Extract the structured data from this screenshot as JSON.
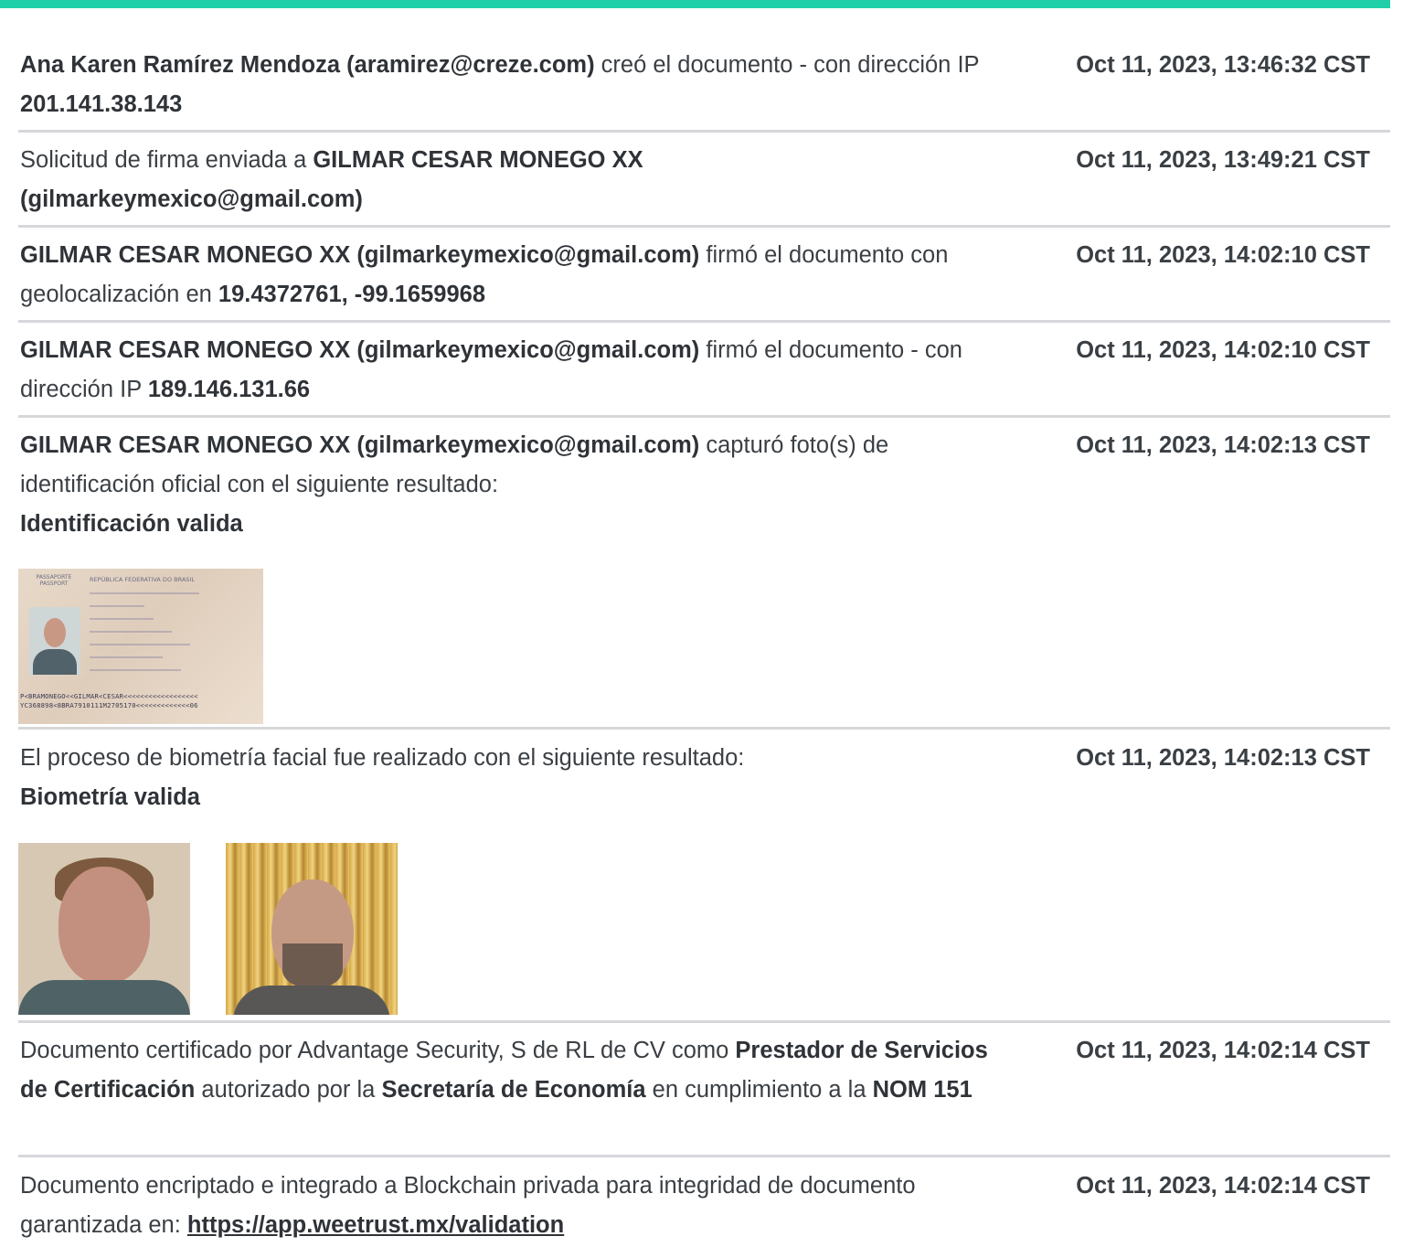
{
  "colors": {
    "accent_bar": "#21cfa8",
    "divider": "#d5d7da"
  },
  "events": [
    {
      "actor": "Ana Karen Ramírez Mendoza (aramirez@creze.com)",
      "action": " creó el documento - con dirección IP ",
      "ip": "201.141.38.143",
      "timestamp": "Oct 11, 2023, 13:46:32 CST"
    },
    {
      "prefix": "Solicitud de firma enviada a ",
      "actor": "GILMAR CESAR MONEGO XX (gilmarkeymexico@gmail.com)",
      "timestamp": "Oct 11, 2023, 13:49:21 CST"
    },
    {
      "actor": "GILMAR CESAR MONEGO XX (gilmarkeymexico@gmail.com)",
      "action": " firmó el documento con geolocalización en ",
      "geo": "19.4372761, -99.1659968",
      "timestamp": "Oct 11, 2023, 14:02:10 CST"
    },
    {
      "actor": "GILMAR CESAR MONEGO XX (gilmarkeymexico@gmail.com)",
      "action": " firmó el documento - con dirección IP ",
      "ip": "189.146.131.66",
      "timestamp": "Oct 11, 2023, 14:02:10 CST"
    },
    {
      "actor": "GILMAR CESAR MONEGO XX (gilmarkeymexico@gmail.com)",
      "action": " capturó foto(s) de identificación oficial con el siguiente resultado:",
      "result": "Identificación valida",
      "timestamp": "Oct 11, 2023, 14:02:13 CST",
      "passport": {
        "header": "PASSAPORTE PASSPORT",
        "title": "REPÚBLICA FEDERATIVA DO BRASIL",
        "mrz1": "P<BRAMONEGO<<GILMAR<CESAR<<<<<<<<<<<<<<<<<<",
        "mrz2": "YC368898<8BRA7910111M2705170<<<<<<<<<<<<<06"
      }
    },
    {
      "text": "El proceso de biometría facial fue realizado con el siguiente resultado:",
      "result": "Biometría valida",
      "timestamp": "Oct 11, 2023, 14:02:13 CST"
    },
    {
      "t1": "Documento certificado por Advantage Security, S de RL de CV como ",
      "b1": "Prestador de Servicios de Certificación",
      "t2": " autorizado por la ",
      "b2": "Secretaría de Economía",
      "t3": " en cumplimiento a la ",
      "b3": "NOM 151",
      "timestamp": "Oct 11, 2023, 14:02:14 CST"
    },
    {
      "text": "Documento encriptado e integrado a Blockchain privada para integridad de documento garantizada en: ",
      "link": "https://app.weetrust.mx/validation",
      "timestamp": "Oct 11, 2023, 14:02:14 CST"
    }
  ]
}
